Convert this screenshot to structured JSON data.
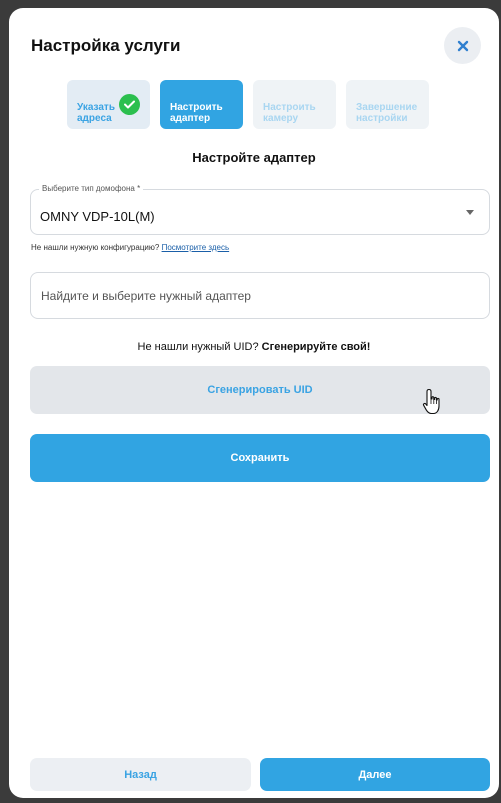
{
  "dialog": {
    "title": "Настройка услуги",
    "close_icon": "close-icon"
  },
  "steps": [
    {
      "label": "Указать\nадреса",
      "state": "done",
      "icon": "check-circle-icon"
    },
    {
      "label": "Настроить\nадаптер",
      "state": "active"
    },
    {
      "label": "Настроить\nкамеру",
      "state": "todo"
    },
    {
      "label": "Завершение\nнастройки",
      "state": "todo"
    }
  ],
  "section_title": "Настройте адаптер",
  "intercom_select": {
    "label": "Выберите тип домофона *",
    "value": "OMNY VDP-10L(M)"
  },
  "hint": {
    "text": "Не нашли нужную конфигурацию?",
    "link": "Посмотрите здесь"
  },
  "adapter_search": {
    "placeholder": "Найдите и выберите нужный адаптер",
    "value": ""
  },
  "uid_prompt": {
    "text": "Не нашли нужный UID?",
    "emphasis": "Сгенерируйте свой!"
  },
  "buttons": {
    "generate_uid": "Сгенерировать UID",
    "save": "Сохранить",
    "back": "Назад",
    "next": "Далее"
  },
  "colors": {
    "accent": "#31a4e2",
    "success": "#2bbf4e",
    "backdrop": "#3b3b3b"
  }
}
